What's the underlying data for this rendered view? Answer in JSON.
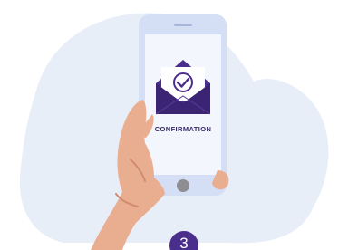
{
  "screen": {
    "label": "CONFIRMATION"
  },
  "step": {
    "number": "3"
  },
  "icons": {
    "envelope": "envelope-check-icon",
    "checkmark": "checkmark-icon"
  },
  "colors": {
    "background_blob": "#e8eef8",
    "phone_body": "#d4def5",
    "phone_screen": "#f3f6fc",
    "envelope": "#4a2e8c",
    "badge": "#4a2e8c",
    "skin": "#e9ad8f",
    "skin_shadow": "#d18c70"
  }
}
